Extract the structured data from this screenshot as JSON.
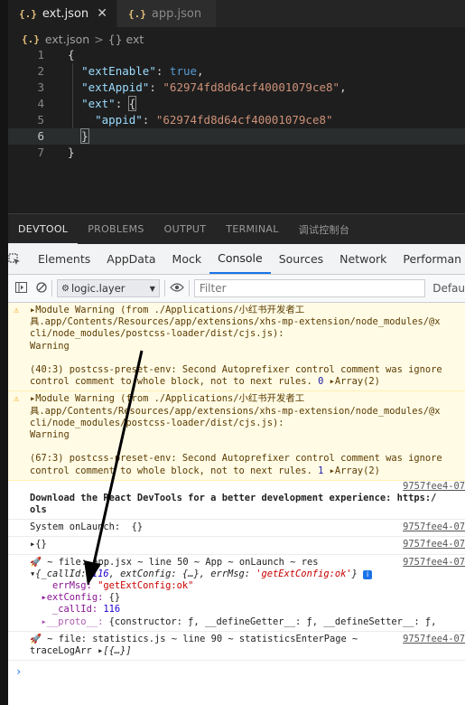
{
  "editor": {
    "tabs": [
      {
        "icon": "{.}",
        "label": "ext.json",
        "close": "✕"
      },
      {
        "icon": "{.}",
        "label": "app.json"
      }
    ],
    "breadcrumb": {
      "file": "ext.json",
      "sep": ">",
      "node": "{} ext"
    },
    "lines": [
      "1",
      "2",
      "3",
      "4",
      "5",
      "6",
      "7"
    ],
    "code": {
      "open": "{",
      "k1": "\"extEnable\"",
      "v1": "true",
      "k2": "\"extAppid\"",
      "v2": "\"62974fd8d64cf40001079ce8\"",
      "k3": "\"ext\"",
      "v3": "{",
      "k4": "\"appid\"",
      "v4": "\"62974fd8d64cf40001079ce8\"",
      "close_inner": "}",
      "close": "}"
    }
  },
  "panel": {
    "tabs": [
      "DEVTOOL",
      "PROBLEMS",
      "OUTPUT",
      "TERMINAL",
      "调试控制台"
    ]
  },
  "devtools": {
    "tabs": [
      "Elements",
      "AppData",
      "Mock",
      "Console",
      "Sources",
      "Network",
      "Performan"
    ],
    "context": "logic.layer",
    "filter_placeholder": "Filter",
    "levels": "Defau",
    "console": {
      "w1_l1": "▸Module Warning (from ./Applications/小红书开发者工",
      "w1_l2": "具.app/Contents/Resources/app/extensions/xhs-mp-extension/node_modules/@x",
      "w1_l3": "cli/node_modules/postcss-loader/dist/cjs.js):",
      "w1_l4": "Warning",
      "w1_l5": "(40:3) postcss-preset-env: Second Autoprefixer control comment was ignore",
      "w1_l6": "control comment to whole block, not to next rules.",
      "w1_n": "0",
      "w1_arr": "▸Array(2)",
      "w2_l1": "▸Module Warning (from ./Applications/小红书开发者工",
      "w2_l2": "具.app/Contents/Resources/app/extensions/xhs-mp-extension/node_modules/@x",
      "w2_l3": "cli/node_modules/postcss-loader/dist/cjs.js):",
      "w2_l4": "Warning",
      "w2_l5": "(67:3) postcss-preset-env: Second Autoprefixer control comment was ignore",
      "w2_l6": "control comment to whole block, not to next rules.",
      "w2_n": "1",
      "w2_arr": "▸Array(2)",
      "src": "9757fee4-07",
      "r1_l1": "Download the React DevTools for a better development experience: https:/",
      "r1_l2": "ols",
      "r2": "System onLaunch:  {}",
      "r3": "▸{}",
      "r4": "🚀 ~ file: app.jsx ~ line 50 ~ App ~ onLaunch ~ res",
      "obj_head_a": "▾{_callId: ",
      "obj_head_num": "116",
      "obj_head_b": ", extConfig: {…}, errMsg: ",
      "obj_head_str": "'getExtConfig:ok'",
      "obj_head_c": "}",
      "obj_badge": "i",
      "errmsg_k": "errMsg: ",
      "errmsg_v": "\"getExtConfig:ok\"",
      "extcfg_k": "▸extConfig: ",
      "extcfg_v": "{}",
      "callid_k": "_callId: ",
      "callid_v": "116",
      "proto_k": "▸__proto__: ",
      "proto_v": "{constructor: ƒ, __defineGetter__: ƒ, __defineSetter__: ƒ,",
      "r5_l1": "🚀 ~ file: statistics.js ~ line 90 ~ statisticsEnterPage ~",
      "r5_l2a": "traceLogArr ",
      "r5_l2b": "▸[{…}]",
      "prompt": "›"
    }
  },
  "colors": {
    "accent": "#1a73e8",
    "warning_bg": "#fffbe5"
  }
}
